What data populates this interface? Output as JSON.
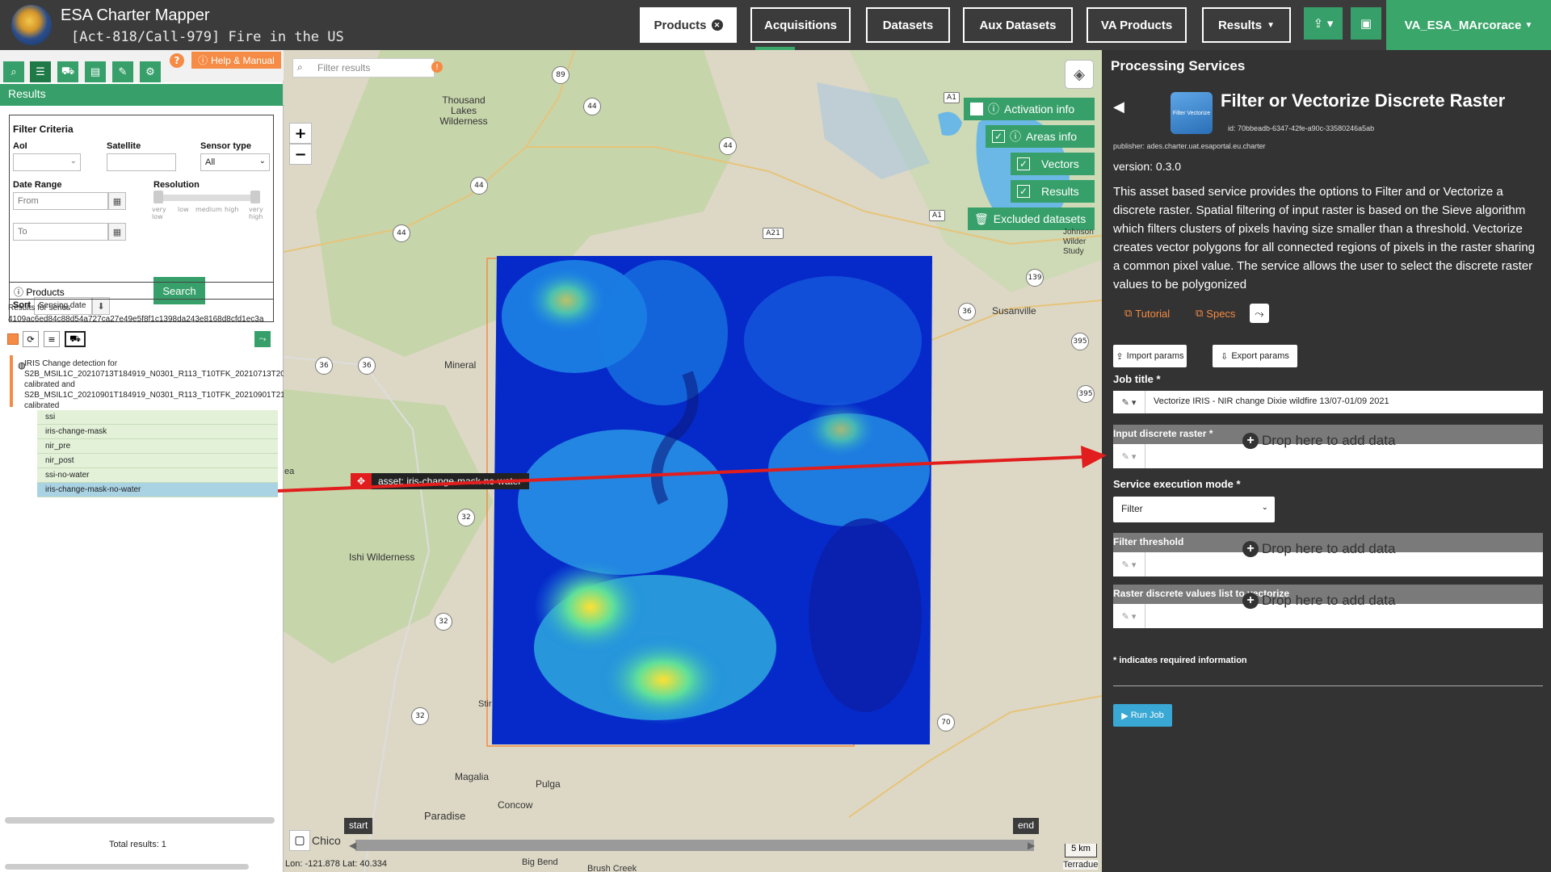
{
  "header": {
    "app_title": "ESA Charter Mapper",
    "activation": "[Act-818/Call-979] Fire in the US",
    "nav": [
      {
        "label": "Products",
        "active": true
      },
      {
        "label": "Acquisitions"
      },
      {
        "label": "Datasets"
      },
      {
        "label": "Aux Datasets"
      },
      {
        "label": "VA Products"
      },
      {
        "label": "Results"
      }
    ],
    "user": "VA_ESA_MArcorace"
  },
  "left": {
    "help_label": "Help & Manual",
    "results_title": "Results",
    "filter": {
      "title": "Filter Criteria",
      "aoi_label": "AoI",
      "satellite_label": "Satellite",
      "sensor_label": "Sensor type",
      "sensor_value": "All",
      "date_range_label": "Date Range",
      "from_placeholder": "From",
      "to_placeholder": "To",
      "resolution_label": "Resolution",
      "resolution_ticks": [
        "very low",
        "low",
        "medium",
        "high",
        "very high"
      ],
      "search_label": "Search",
      "sort_label": "Sort",
      "sort_value": "Sensing date"
    },
    "products_title": "Products",
    "series_label": "Results for series",
    "series_id": "4109ac6ed84c88d54a727ca27e49e5f8f1c1398da243e8168d8cfd1ec3a",
    "result_title": "IRIS Change detection for S2B_MSIL1C_20210713T184919_N0301_R113_T10TFK_20210713T205848-calibrated and S2B_MSIL1C_20210901T184919_N0301_R113_T10TFK_20210901T210126-calibrated",
    "assets": [
      "ssi",
      "iris-change-mask",
      "nir_pre",
      "nir_post",
      "ssi-no-water",
      "iris-change-mask-no-water"
    ],
    "total": "Total results: 1"
  },
  "map": {
    "search_placeholder": "Filter results",
    "toggles": [
      {
        "label": "Activation info",
        "checked": false
      },
      {
        "label": "Areas info",
        "checked": true
      },
      {
        "label": "Vectors",
        "checked": true
      },
      {
        "label": "Results",
        "checked": true
      }
    ],
    "excluded_label": "Excluded datasets",
    "asset_tag": "asset: iris-change-mask-no-water",
    "places": [
      "Thousand Lakes Wilderness",
      "Susanville",
      "Mineral",
      "Ishi Wilderness",
      "Paradise",
      "Magalia",
      "Pulga",
      "Concow",
      "Chico",
      "Big Bend",
      "Brush Creek",
      "Johnson Wilder Study",
      "ea",
      "Stir"
    ],
    "highways": [
      "89",
      "44",
      "44",
      "44",
      "44",
      "A1",
      "A21",
      "A1",
      "139",
      "36",
      "36",
      "36",
      "395",
      "395",
      "32",
      "32",
      "32",
      "70"
    ],
    "timeline_start": "start",
    "timeline_end": "end",
    "lonlat": "Lon: -121.878 Lat: 40.334",
    "scale": "5 km",
    "attribution": "Terradue"
  },
  "right": {
    "panel_title": "Processing Services",
    "service_title": "Filter or Vectorize Discrete Raster",
    "icon_text": "Filter Vectorize",
    "service_id": "id: 70bbeadb-6347-42fe-a90c-33580246a5ab",
    "publisher": "publisher: ades.charter.uat.esaportal.eu.charter",
    "version": "version: 0.3.0",
    "description": "This asset based service provides the options to Filter and or Vectorize a discrete raster. Spatial filtering of input raster is based on the Sieve algorithm which filters clusters of pixels having size smaller than a threshold. Vectorize creates vector polygons for all connected regions of pixels in the raster sharing a common pixel value. The service allows the user to select the discrete raster values to be polygonized",
    "tutorial": "Tutorial",
    "specs": "Specs",
    "import_params": "Import params",
    "export_params": "Export params",
    "job_title_label": "Job title *",
    "job_title_value": "Vectorize IRIS - NIR change Dixie wildfire 13/07-01/09 2021",
    "input_raster_label": "Input discrete raster *",
    "drop_text": "Drop here to add data",
    "exec_mode_label": "Service execution mode *",
    "exec_mode_value": "Filter",
    "filter_threshold_label": "Filter threshold",
    "raster_values_label": "Raster discrete values list to vectorize",
    "required_note": "* indicates required information",
    "run_job": "Run Job"
  }
}
